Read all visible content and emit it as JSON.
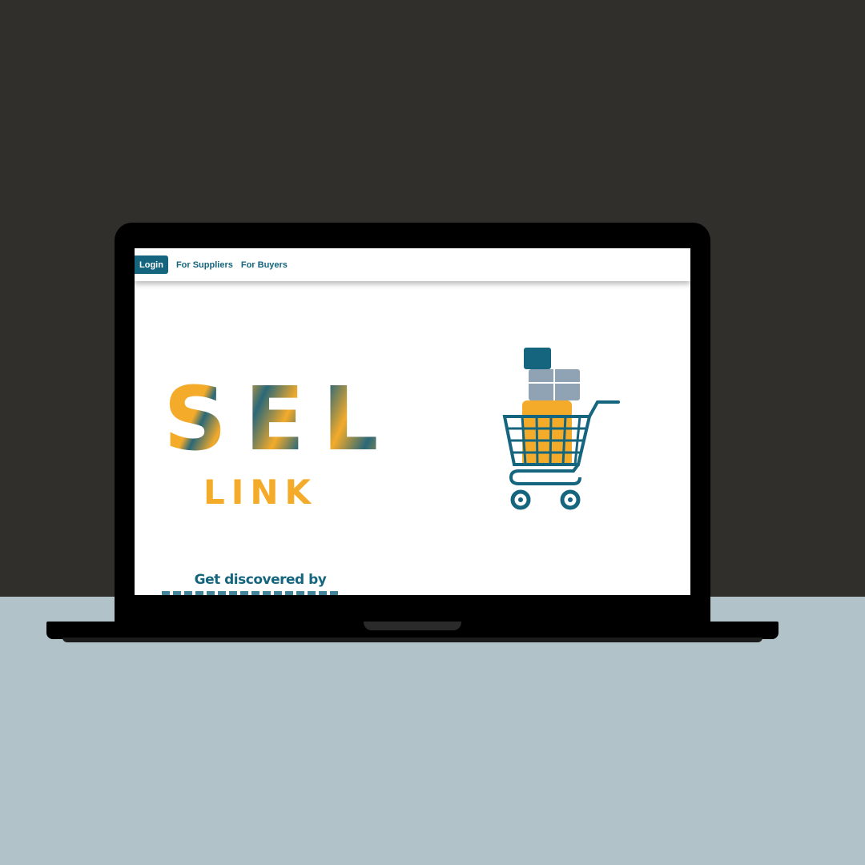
{
  "nav": {
    "login_label": "Login",
    "for_suppliers_label": "For Suppliers",
    "for_buyers_label": "For Buyers"
  },
  "logo": {
    "letters": "SEL",
    "subtext": "LINK"
  },
  "hero": {
    "tagline": "Get discovered by"
  },
  "colors": {
    "brand_teal": "#15657e",
    "brand_orange": "#f4ab2a",
    "box_gray": "#8fa3b5",
    "wall": "#302f2b",
    "desk": "#b1c2c9"
  },
  "icons": {
    "cart": "shopping-cart-icon"
  }
}
